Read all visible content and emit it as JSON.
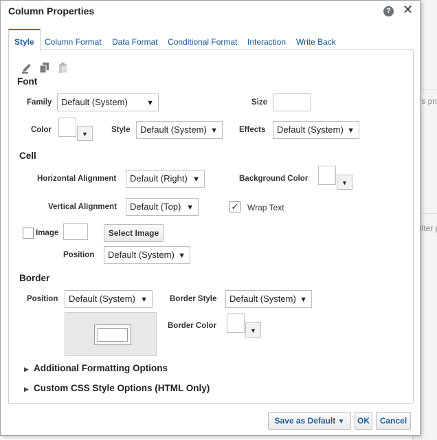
{
  "background": {
    "text1": "'s pro",
    "text2": "ilter p"
  },
  "dialog": {
    "title": "Column Properties",
    "help_glyph": "?",
    "close_glyph": "✕"
  },
  "tabs": [
    "Style",
    "Column Format",
    "Data Format",
    "Conditional Format",
    "Interaction",
    "Write Back"
  ],
  "font": {
    "heading": "Font",
    "family_label": "Family",
    "family_value": "Default (System)",
    "size_label": "Size",
    "size_value": "",
    "color_label": "Color",
    "style_label": "Style",
    "style_value": "Default (System)",
    "effects_label": "Effects",
    "effects_value": "Default (System)"
  },
  "cell": {
    "heading": "Cell",
    "h_align_label": "Horizontal Alignment",
    "h_align_value": "Default (Right)",
    "bg_color_label": "Background Color",
    "v_align_label": "Vertical Alignment",
    "v_align_value": "Default (Top)",
    "wrap_text_label": "Wrap Text",
    "wrap_text_checked": true,
    "image_label": "Image",
    "image_checked": false,
    "select_image_label": "Select Image",
    "position_label": "Position",
    "position_value": "Default (System)"
  },
  "border": {
    "heading": "Border",
    "position_label": "Position",
    "position_value": "Default (System)",
    "style_label": "Border Style",
    "style_value": "Default (System)",
    "color_label": "Border Color"
  },
  "expanders": {
    "additional": "Additional Formatting Options",
    "custom_css": "Custom CSS Style Options (HTML Only)"
  },
  "footer": {
    "save_default": "Save as Default",
    "ok": "OK",
    "cancel": "Cancel"
  },
  "glyphs": {
    "caret": "▼",
    "check": "✓",
    "tri": "▶"
  },
  "icons": [
    "brush-icon",
    "copy-icon",
    "paste-icon"
  ],
  "colors": {
    "accent": "#1e73be",
    "link": "#0b5394"
  }
}
